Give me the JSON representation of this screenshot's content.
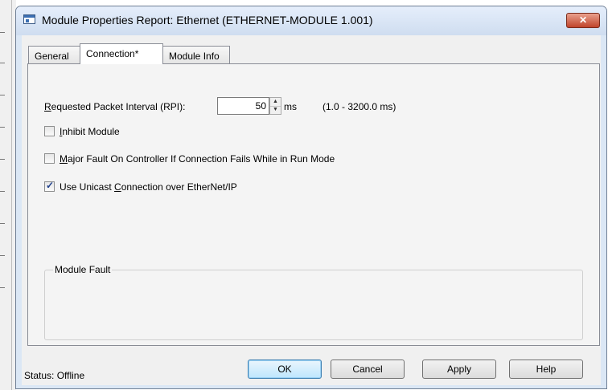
{
  "window": {
    "title": "Module Properties Report: Ethernet (ETHERNET-MODULE 1.001)",
    "close_glyph": "✕"
  },
  "tabs": [
    {
      "label": "General",
      "active": false
    },
    {
      "label": "Connection*",
      "active": true
    },
    {
      "label": "Module Info",
      "active": false
    }
  ],
  "connection": {
    "rpi_label_mnemonic": "R",
    "rpi_label_rest": "equested Packet Interval (RPI):",
    "rpi_value": "50",
    "rpi_unit": "ms",
    "rpi_range": "(1.0 - 3200.0 ms)",
    "inhibit": {
      "mnemonic": "I",
      "rest": "nhibit Module",
      "checked": false
    },
    "major_fault": {
      "mnemonic": "M",
      "rest": "ajor Fault On Controller If Connection Fails While in Run Mode",
      "checked": false
    },
    "unicast": {
      "before": "Use Unicast ",
      "mnemonic": "C",
      "after": "onnection over EtherNet/IP",
      "checked": true
    },
    "module_fault_label": "Module Fault"
  },
  "footer": {
    "status": "Status:  Offline",
    "ok": "OK",
    "cancel": "Cancel",
    "apply": "Apply",
    "help": "Help"
  },
  "colors": {
    "title_bg": "#dbe7f5",
    "close_button": "#c0442b",
    "dialog_bg": "#f0f0f0"
  }
}
